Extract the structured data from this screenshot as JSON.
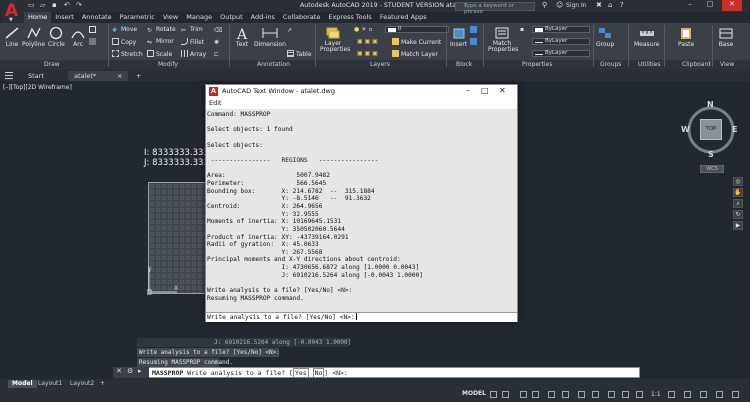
{
  "window": {
    "title": "Autodesk AutoCAD 2019 - STUDENT VERSION    atalet.dwg",
    "search_placeholder": "Type a keyword or phrase",
    "sign_in": "Sign In",
    "min": "–",
    "max": "□",
    "close": "✕"
  },
  "ribbon_tabs": [
    "Home",
    "Insert",
    "Annotate",
    "Parametric",
    "View",
    "Manage",
    "Output",
    "Add-ins",
    "Collaborate",
    "Express Tools",
    "Featured Apps"
  ],
  "ribbon": {
    "draw": {
      "line": "Line",
      "polyline": "Polyline",
      "circle": "Circle",
      "arc": "Arc",
      "panel": "Draw"
    },
    "modify": {
      "move": "Move",
      "rotate": "Rotate",
      "trim": "Trim",
      "copy": "Copy",
      "mirror": "Mirror",
      "fillet": "Fillet",
      "stretch": "Stretch",
      "scale": "Scale",
      "array": "Array",
      "panel": "Modify"
    },
    "annotation": {
      "text": "Text",
      "dimension": "Dimension",
      "table": "Table",
      "panel": "Annotation"
    },
    "layers": {
      "layer_properties": "Layer Properties",
      "layer_value": "0",
      "make_current": "Make Current",
      "match_layer": "Match Layer",
      "panel": "Layers"
    },
    "block": {
      "insert": "Insert",
      "panel": "Block"
    },
    "properties": {
      "match": "Match Properties",
      "bylayer1": "ByLayer",
      "bylayer2": "ByLayer",
      "bylayer3": "ByLayer",
      "panel": "Properties"
    },
    "groups": {
      "group": "Group",
      "panel": "Groups"
    },
    "utilities": {
      "measure": "Measure",
      "panel": "Utilities"
    },
    "clipboard": {
      "paste": "Paste",
      "panel": "Clipboard"
    },
    "view": {
      "base": "Base",
      "panel": "View"
    }
  },
  "doc_tabs": {
    "start": "Start",
    "active": "atalet*",
    "add": "+"
  },
  "viewport_label": "[–][Top][2D Wireframe]",
  "drawing": {
    "dim1": "I: 8333333.3333",
    "dim2": "J: 8333333.3333"
  },
  "viewcube": {
    "top": "TOP",
    "n": "N",
    "s": "S",
    "e": "E",
    "w": "W",
    "wcs": "WCS"
  },
  "text_window": {
    "title": "AutoCAD Text Window - atalet.dwg",
    "menu_edit": "Edit",
    "lines": [
      "Command: MASSPROP",
      "",
      "Select objects: 1 found",
      "",
      "Select objects:",
      "",
      " ----------------   REGIONS   ----------------",
      "",
      "Area:                   5007.9482",
      "Perimeter:              566.5645",
      "Bounding box:       X: 214.6782  --  315.1884",
      "                    Y: -8.5146   --  91.3632",
      "Centroid:           X: 264.9656",
      "                    Y: 32.9555",
      "Moments of inertia: X: 10169645.1531",
      "                    Y: 350502060.5644",
      "Product of inertia: XY: -43739164.0291",
      "Radii of gyration:  X: 45.0633",
      "                    Y: 267.5568",
      "Principal moments and X-Y directions about centroid:",
      "                    I: 4730656.6872 along [1.0000 0.0043]",
      "                    J: 6910216.5264 along [-0.0043 1.0000]",
      "",
      "Write analysis to a file? [Yes/No] <N>:",
      "Resuming MASSPROP command."
    ],
    "prompt": "Write analysis to a file? [Yes/No] <N>:"
  },
  "cmd_history": [
    "J: 6910216.5264 along [-0.0043 1.0000]",
    "Write analysis to a file? [Yes/No] <N>:",
    "Resuming MASSPROP command."
  ],
  "cmdline": {
    "command": "MASSPROP",
    "prompt": "Write analysis to a file? [",
    "opt_yes": "Yes",
    "opt_no": "No",
    "tail": "] <N>:"
  },
  "layout_tabs": [
    "Model",
    "Layout1",
    "Layout2"
  ],
  "status": {
    "model": "MODEL",
    "scale": "1:1"
  }
}
